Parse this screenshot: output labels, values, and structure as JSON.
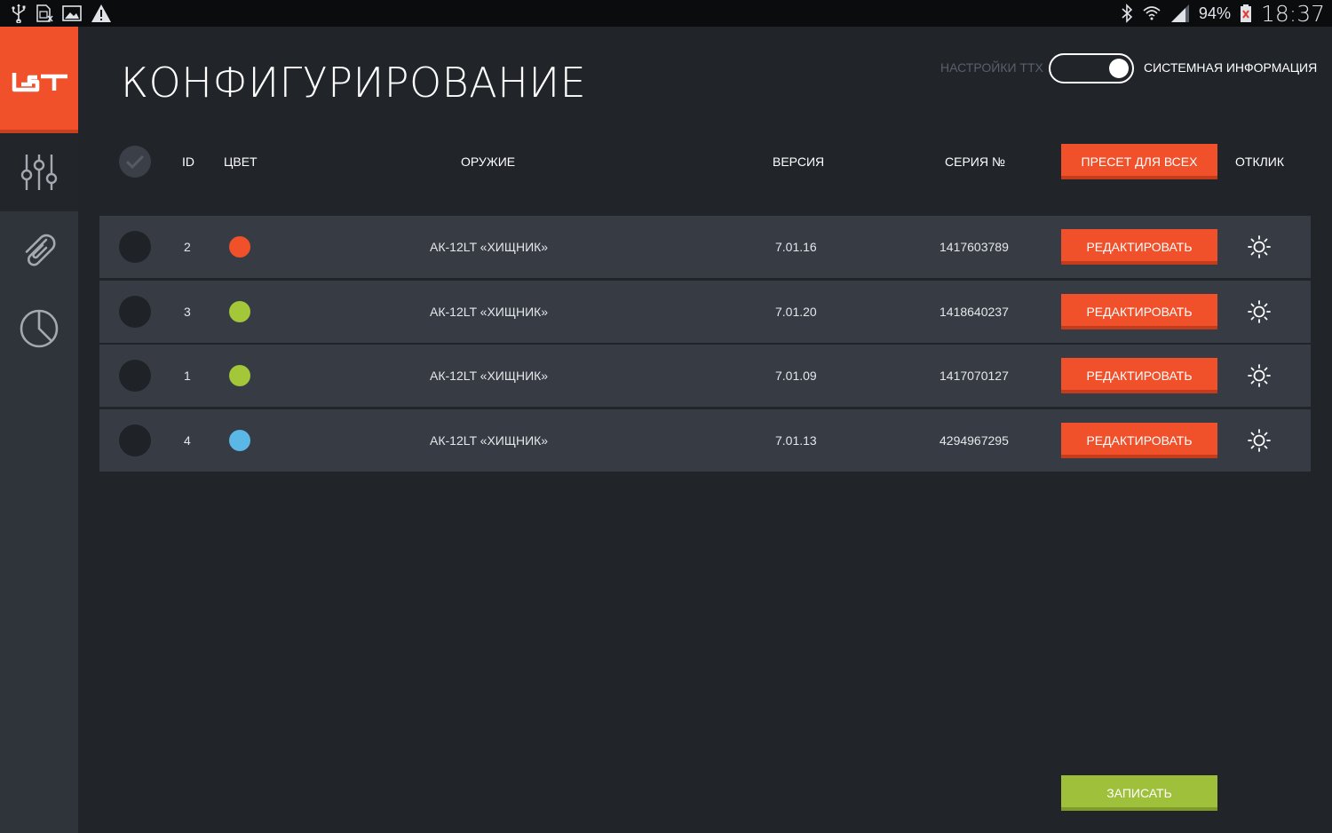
{
  "status_bar": {
    "battery_text": "94%",
    "time": "18:37"
  },
  "header": {
    "title": "КОНФИГУРИРОВАНИЕ",
    "mode_left": "НАСТРОЙКИ ТТХ",
    "mode_right": "СИСТЕМНАЯ ИНФОРМАЦИЯ",
    "toggle_state": "right"
  },
  "table": {
    "columns": {
      "id": "ID",
      "color": "ЦВЕТ",
      "weapon": "ОРУЖИЕ",
      "version": "ВЕРСИЯ",
      "serial": "СЕРИЯ №",
      "response": "ОТКЛИК"
    },
    "preset_all_label": "ПРЕСЕТ ДЛЯ ВСЕХ",
    "rows": [
      {
        "id": "2",
        "color": "#f0502a",
        "weapon": "АК-12LT «ХИЩНИК»",
        "version": "7.01.16",
        "serial": "1417603789",
        "edit_label": "РЕДАКТИРОВАТЬ"
      },
      {
        "id": "3",
        "color": "#a4c639",
        "weapon": "АК-12LT «ХИЩНИК»",
        "version": "7.01.20",
        "serial": "1418640237",
        "edit_label": "РЕДАКТИРОВАТЬ"
      },
      {
        "id": "1",
        "color": "#a4c639",
        "weapon": "АК-12LT «ХИЩНИК»",
        "version": "7.01.09",
        "serial": "1417070127",
        "edit_label": "РЕДАКТИРОВАТЬ"
      },
      {
        "id": "4",
        "color": "#5bb8e6",
        "weapon": "АК-12LT «ХИЩНИК»",
        "version": "7.01.13",
        "serial": "4294967295",
        "edit_label": "РЕДАКТИРОВАТЬ"
      }
    ]
  },
  "footer": {
    "write_label": "ЗАПИСАТЬ"
  },
  "colors": {
    "accent": "#f0502a",
    "success": "#9fc03a",
    "background": "#212429",
    "sidebar": "#2f343b",
    "row": "#373c44"
  },
  "icons": {
    "status_left": [
      "usb-icon",
      "sim-icon",
      "image-icon",
      "warning-icon"
    ],
    "status_right": [
      "bluetooth-icon",
      "wifi-icon",
      "signal-icon",
      "battery-icon"
    ],
    "sidebar": [
      "logo-icon",
      "sliders-icon",
      "paperclip-icon",
      "pie-chart-icon"
    ],
    "row_action": "sun-icon"
  }
}
